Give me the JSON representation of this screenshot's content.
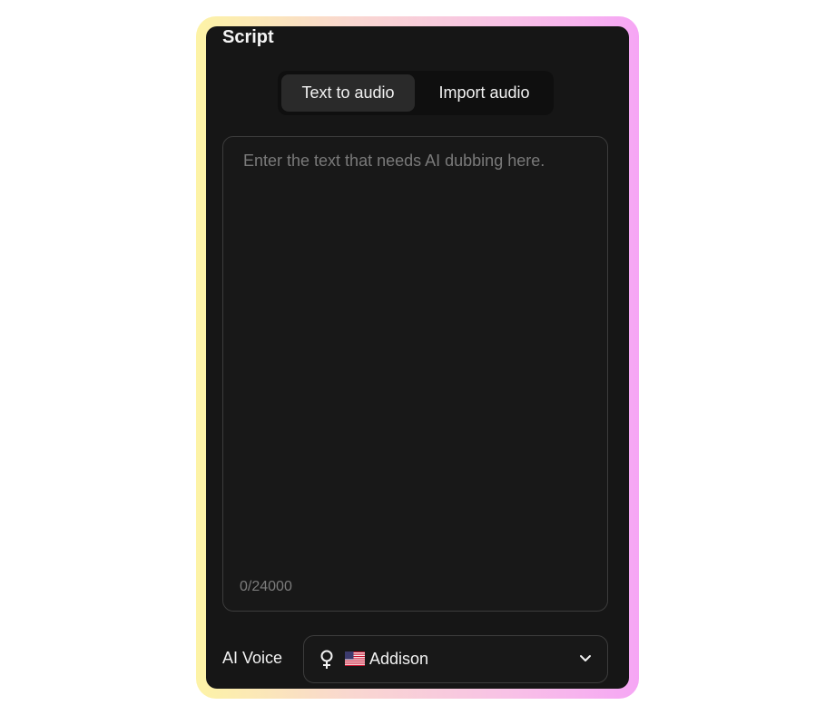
{
  "panel": {
    "title": "Script"
  },
  "tabs": [
    {
      "label": "Text to audio",
      "active": true
    },
    {
      "label": "Import audio",
      "active": false
    }
  ],
  "script": {
    "value": "",
    "placeholder": "Enter the text that needs AI dubbing here.",
    "counter": "0/24000"
  },
  "voice": {
    "label": "AI Voice",
    "selected": "Addison",
    "gender_icon": "female-icon",
    "flag_icon": "us-flag-icon",
    "dropdown_icon": "chevron-down-icon"
  },
  "colors": {
    "panel_bg": "#161616",
    "border": "#3c3c3c",
    "frame_gradient_start": "#fdf3a6",
    "frame_gradient_end": "#f6a6f5"
  }
}
